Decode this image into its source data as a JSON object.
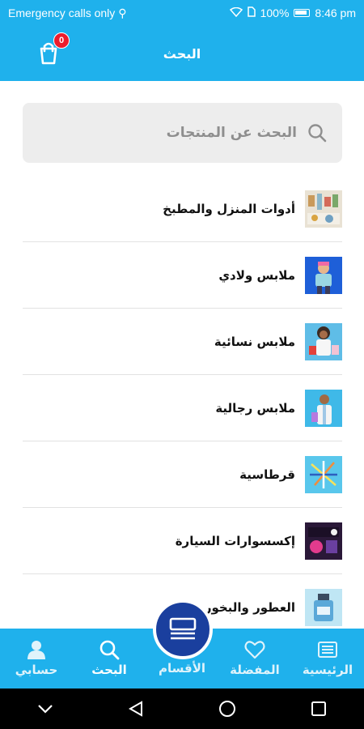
{
  "status_bar": {
    "carrier": "Emergency calls only",
    "battery": "100%",
    "time": "8:46 pm"
  },
  "app_bar": {
    "title": "البحث",
    "cart_count": "0"
  },
  "search": {
    "placeholder": "البحث عن المنتجات"
  },
  "categories": [
    {
      "label": "أدوات المنزل والمطبخ",
      "icon": "kitchen-tools-image"
    },
    {
      "label": "ملابس ولادي",
      "icon": "boys-clothes-image"
    },
    {
      "label": "ملابس نسائية",
      "icon": "womens-clothes-image"
    },
    {
      "label": "ملابس رجالية",
      "icon": "mens-clothes-image"
    },
    {
      "label": "قرطاسية",
      "icon": "stationery-image"
    },
    {
      "label": "إكسسوارات السيارة",
      "icon": "car-accessories-image"
    },
    {
      "label": "العطور والبخور",
      "icon": "perfume-image"
    }
  ],
  "bottom_nav": {
    "account": "حسابي",
    "search": "البحث",
    "sections": "الأقسام",
    "favorites": "المفضلة",
    "home": "الرئيسية"
  },
  "colors": {
    "primary": "#1fb1ec",
    "fab": "#1a3f9e",
    "badge": "#ec1c2c"
  }
}
